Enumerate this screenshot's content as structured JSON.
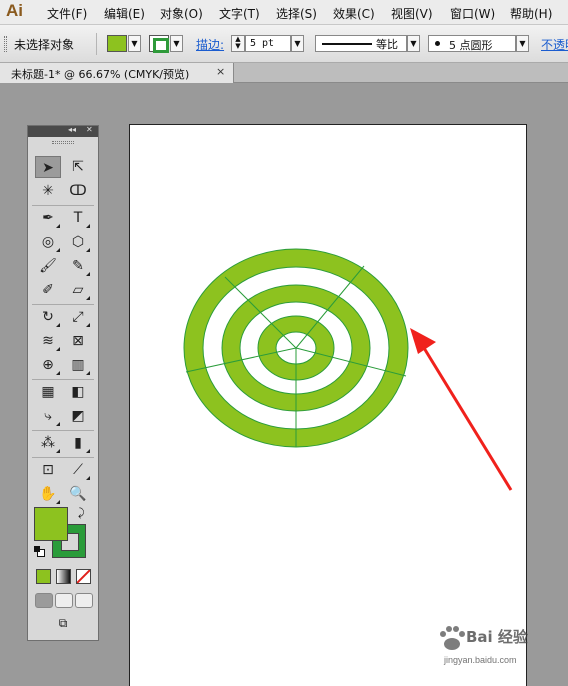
{
  "app": {
    "logo": "Ai"
  },
  "menu": [
    {
      "label": "文件(F)",
      "id": "file"
    },
    {
      "label": "编辑(E)",
      "id": "edit"
    },
    {
      "label": "对象(O)",
      "id": "object"
    },
    {
      "label": "文字(T)",
      "id": "type"
    },
    {
      "label": "选择(S)",
      "id": "select"
    },
    {
      "label": "效果(C)",
      "id": "effect"
    },
    {
      "label": "视图(V)",
      "id": "view"
    },
    {
      "label": "窗口(W)",
      "id": "window"
    },
    {
      "label": "帮助(H)",
      "id": "help"
    }
  ],
  "control": {
    "selection_label": "未选择对象",
    "stroke_label": "描边:",
    "stroke_weight": "5 pt",
    "profile_label": "等比",
    "brush_label": "5 点圆形",
    "opacity_label": "不透明"
  },
  "document": {
    "tab_title": "未标题-1* @ 66.67% (CMYK/预览)",
    "close_glyph": "×"
  },
  "colors": {
    "fill": "#8dc21f",
    "stroke": "#2a9c3a",
    "arrow": "#f0211c"
  },
  "tools_panel": {
    "collapse_glyph": "◂◂",
    "close_glyph": "✕"
  },
  "watermark": {
    "text": "Bai 经验",
    "url": "jingyan.baidu.com"
  }
}
